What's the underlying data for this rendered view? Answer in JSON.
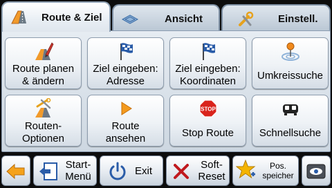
{
  "tabs": [
    {
      "label": "Route & Ziel",
      "icon": "road-icon",
      "active": true
    },
    {
      "label": "Ansicht",
      "icon": "map-icon",
      "active": false
    },
    {
      "label": "Einstell.",
      "icon": "tools-icon",
      "active": false
    }
  ],
  "menu": [
    {
      "label": "Route planen\n& ändern",
      "icon": "route-edit-icon"
    },
    {
      "label": "Ziel eingeben:\nAdresse",
      "icon": "checkered-flag-icon"
    },
    {
      "label": "Ziel eingeben:\nKoordinaten",
      "icon": "checkered-flag-icon"
    },
    {
      "label": "Umkreissuche",
      "icon": "map-pin-icon"
    },
    {
      "label": "Routen-\nOptionen",
      "icon": "route-tools-icon"
    },
    {
      "label": "Route\nansehen",
      "icon": "play-icon"
    },
    {
      "label": "Stop Route",
      "icon": "stop-sign-icon"
    },
    {
      "label": "Schnellsuche",
      "icon": "car-icon"
    }
  ],
  "bottom": {
    "back_icon": "back-arrow-icon",
    "start_menu": "Start-\nMenü",
    "exit": "Exit",
    "softreset": "Soft-\nReset",
    "pos_save": "Pos.\nspeicher",
    "view_icon": "eye-icon"
  },
  "colors": {
    "accent": "#2a5ca8",
    "exit_red": "#c0191e",
    "back_orange": "#f5a21a",
    "star": "#f4b400"
  }
}
